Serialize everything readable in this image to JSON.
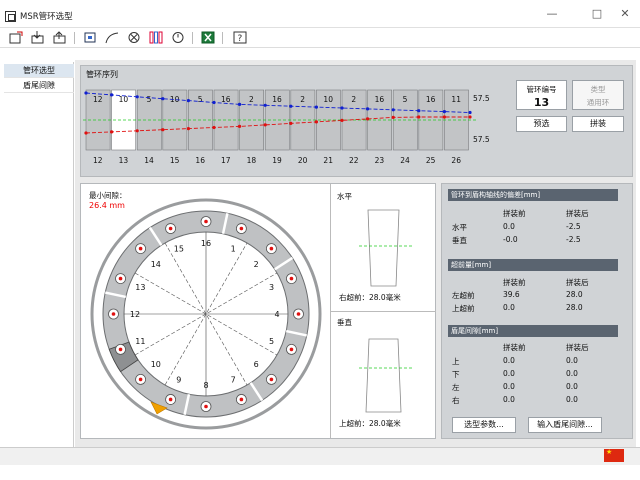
{
  "window": {
    "title": "MSR管环选型",
    "minimize": "—",
    "maximize": "□",
    "close": "✕"
  },
  "toolbar": {
    "icons": [
      "new-icon",
      "import-icon",
      "export-icon",
      "measure-icon",
      "curve-icon",
      "cancel-icon",
      "ring-icon",
      "gauge-icon",
      "excel-icon",
      "help-icon"
    ]
  },
  "nav": {
    "items": [
      {
        "label": "管环选型",
        "active": true
      },
      {
        "label": "盾尾间隙",
        "active": false
      }
    ]
  },
  "sequence": {
    "title": "管环序列",
    "ring_numbers": [
      "12",
      "13",
      "14",
      "15",
      "16",
      "17",
      "18",
      "19",
      "20",
      "21",
      "22",
      "23",
      "24",
      "25",
      "26"
    ],
    "keys": [
      "12",
      "10",
      "5",
      "10",
      "5",
      "16",
      "2",
      "16",
      "2",
      "10",
      "2",
      "16",
      "5",
      "16",
      "11"
    ],
    "right_top": "57.5",
    "right_bottom": "57.5",
    "highlight_index": 1
  },
  "ring_info": {
    "number_label": "管环编号",
    "number_value": "13",
    "type_label": "类型",
    "type_value": "通用环",
    "preselect": "预选",
    "assemble": "拼装"
  },
  "ring_view": {
    "min_gap_label": "最小间隙：",
    "min_gap_value": "26.4 mm",
    "positions": [
      "16",
      "1",
      "2",
      "3",
      "4",
      "5",
      "6",
      "7",
      "8",
      "9",
      "10",
      "11",
      "12",
      "13",
      "14",
      "15"
    ]
  },
  "horizontal": {
    "title": "水平",
    "caption": "右超前：28.0毫米"
  },
  "vertical": {
    "title": "垂直",
    "caption": "上超前：28.0毫米"
  },
  "deviation": {
    "title": "管环到盾构轴线的偏差[mm]",
    "before": "拼装前",
    "after": "拼装后",
    "rows": [
      {
        "label": "水平",
        "before": "0.0",
        "after": "-2.5"
      },
      {
        "label": "垂直",
        "before": "-0.0",
        "after": "-2.5"
      }
    ]
  },
  "advance": {
    "title": "超前量[mm]",
    "before": "拼装前",
    "after": "拼装后",
    "rows": [
      {
        "label": "左超前",
        "before": "39.6",
        "after": "28.0"
      },
      {
        "label": "上超前",
        "before": "0.0",
        "after": "28.0"
      }
    ]
  },
  "tail_gap": {
    "title": "盾尾间隙[mm]",
    "before": "拼装前",
    "after": "拼装后",
    "rows": [
      {
        "label": "上",
        "before": "0.0",
        "after": "0.0"
      },
      {
        "label": "下",
        "before": "0.0",
        "after": "0.0"
      },
      {
        "label": "左",
        "before": "0.0",
        "after": "0.0"
      },
      {
        "label": "右",
        "before": "0.0",
        "after": "0.0"
      }
    ]
  },
  "buttons": {
    "type_params": "选型参数...",
    "input_tail_gap": "输入盾尾间隙..."
  },
  "colors": {
    "panel": "#d0d3d6",
    "section": "#5a6470",
    "blue_line": "#1020d0",
    "red_line": "#e01010",
    "green_line": "#22cc22",
    "orange_marker": "#f0a000"
  }
}
